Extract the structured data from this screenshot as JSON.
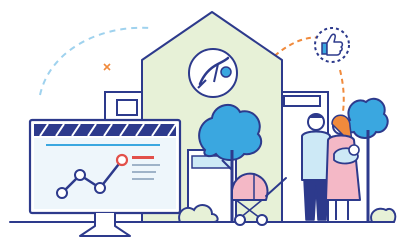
{
  "illustration": {
    "theme": "maternity clinic with online monitoring",
    "icons": [
      "stork-baby-icon",
      "thumbs-up-icon",
      "line-chart-icon",
      "stroller-icon"
    ],
    "colors": {
      "outline": "#2d3a8c",
      "house_fill": "#e7f1d7",
      "accent_blue": "#3aa7e0",
      "accent_pink": "#f4b8c6",
      "accent_red": "#e2504a",
      "tree_fill": "#3aa7e0",
      "light_blue": "#cde9f6",
      "orange_dash": "#f08a3c"
    }
  }
}
